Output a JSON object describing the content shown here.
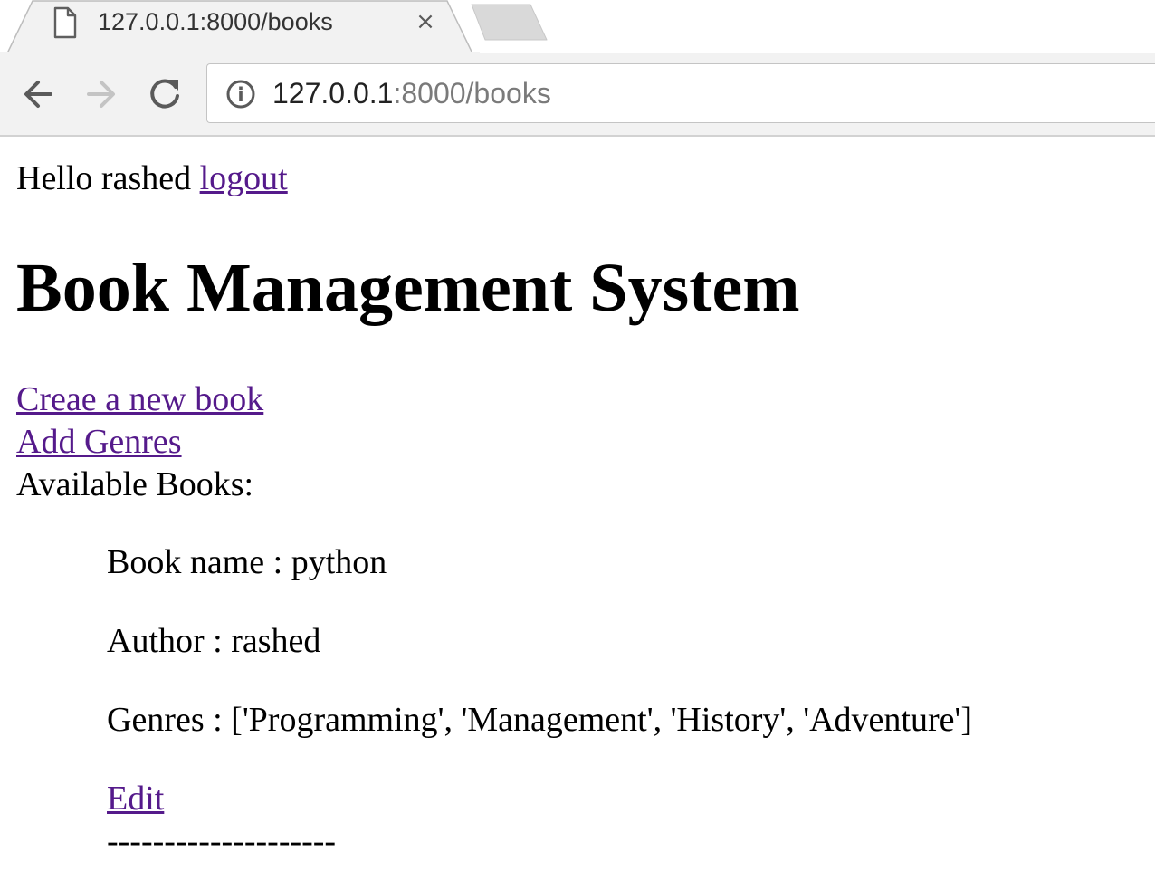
{
  "browser": {
    "tab": {
      "title": "127.0.0.1:8000/books",
      "close_label": "×"
    },
    "address_bar": {
      "host": "127.0.0.1",
      "rest": ":8000/books"
    }
  },
  "page": {
    "greeting_text": "Hello rashed",
    "logout_label": "logout",
    "heading": "Book Management System",
    "create_book_label": "Creae a new book",
    "add_genres_label": "Add Genres",
    "available_books_label": "Available Books:",
    "books": [
      {
        "name_line": "Book name : python",
        "author_line": "Author : rashed",
        "genres_line": "Genres : ['Programming', 'Management', 'History', 'Adventure']",
        "edit_label": "Edit",
        "separator": "--------------------"
      }
    ]
  },
  "colors": {
    "link": "#551a8b",
    "toolbar_bg": "#f2f2f2",
    "tab_bg": "#f2f2f2"
  },
  "icons": [
    "page-icon",
    "close-icon",
    "new-tab-icon",
    "back-arrow-icon",
    "forward-arrow-icon",
    "reload-icon",
    "info-icon"
  ]
}
